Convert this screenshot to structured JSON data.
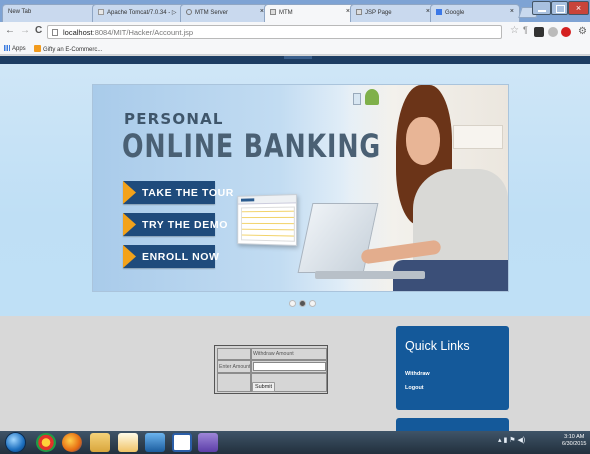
{
  "browser": {
    "tabs": [
      {
        "label": "New Tab",
        "active": false
      },
      {
        "label": "Apache Tomcat/7.0.34 - ▷",
        "active": false
      },
      {
        "label": "MTM Server",
        "active": false
      },
      {
        "label": "MTM",
        "active": true
      },
      {
        "label": "JSP Page",
        "active": false
      },
      {
        "label": "Google",
        "active": false
      }
    ],
    "close_glyph": "×",
    "address": {
      "host": "localhost",
      "path": ":8084/MIT/Hacker/Account.jsp"
    },
    "bookmarks": [
      "Apps",
      "Gifty an E-Commerc..."
    ],
    "nav_icons": [
      "back-icon",
      "forward-icon",
      "reload-icon"
    ],
    "nav_glyphs": {
      "back": "←",
      "forward": "→",
      "reload": "C"
    }
  },
  "banner": {
    "line1": "PERSONAL",
    "line2": "ONLINE BANKING",
    "buttons": [
      "TAKE THE TOUR",
      "TRY THE DEMO",
      "ENROLL NOW"
    ],
    "carousel": {
      "count": 3,
      "active_index": 1
    }
  },
  "withdraw_form": {
    "header": "Withdraw Amount",
    "label": "Enter Amount",
    "input_value": "",
    "submit_label": "Submit"
  },
  "quick_links": {
    "title": "Quick Links",
    "items": [
      "Withdraw",
      "Logout"
    ]
  },
  "taskbar": {
    "clock_time": "3:10 AM",
    "clock_date": "6/30/2015"
  },
  "colors": {
    "nav_dark": "#1d3d63",
    "quick_links_bg": "#14599a",
    "banner_button": "#1f4b7c",
    "banner_arrow": "#f3a21a"
  }
}
